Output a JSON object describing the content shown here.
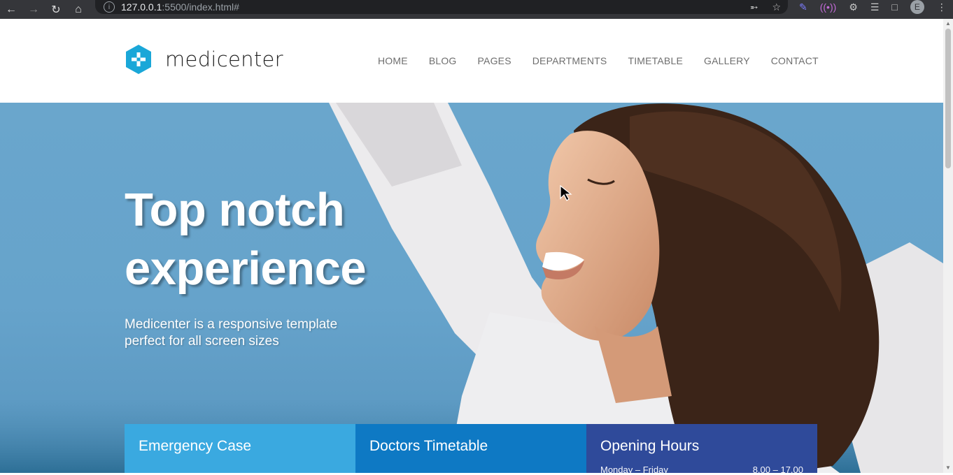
{
  "browser": {
    "url_host": "127.0.0.1",
    "url_rest": ":5500/index.html#",
    "profile_initial": "E"
  },
  "site": {
    "logo_text": "medicenter",
    "nav": [
      "HOME",
      "BLOG",
      "PAGES",
      "DEPARTMENTS",
      "TIMETABLE",
      "GALLERY",
      "CONTACT"
    ]
  },
  "hero": {
    "title_line1": "Top notch",
    "title_line2": "experience",
    "subtitle_line1": "Medicenter is a responsive template",
    "subtitle_line2": "perfect for all screen sizes"
  },
  "boxes": [
    {
      "title": "Emergency Case",
      "color": "#3aa9e0"
    },
    {
      "title": "Doctors Timetable",
      "color": "#0e79c4"
    },
    {
      "title": "Opening Hours",
      "color": "#2f4a9a",
      "row_label": "Monday – Friday",
      "row_value": "8.00 – 17.00"
    }
  ],
  "colors": {
    "brand": "#1aa7d8",
    "sky": "#6aa6cc"
  },
  "icons": [
    "back-arrow-icon",
    "forward-arrow-icon",
    "reload-icon",
    "home-icon",
    "info-icon",
    "share-icon",
    "star-icon",
    "extension-icon",
    "sidebar-icon",
    "menu-icon"
  ]
}
